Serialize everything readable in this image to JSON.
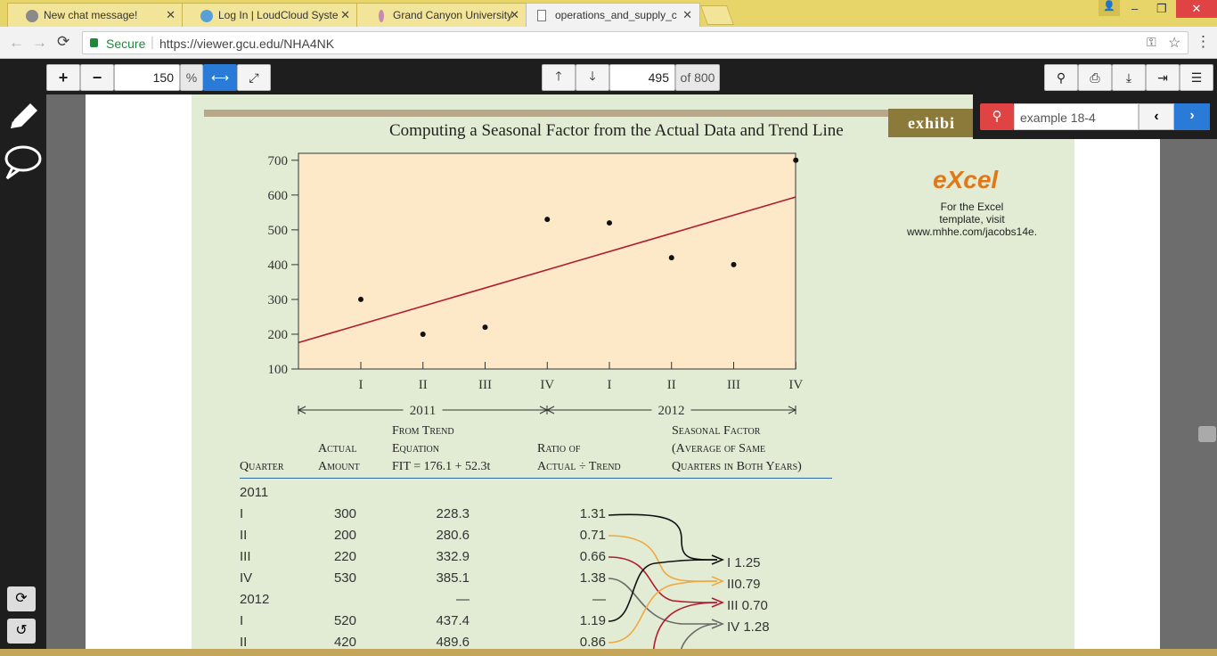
{
  "browser": {
    "tabs": [
      {
        "title": "New chat message!"
      },
      {
        "title": "Log In | LoudCloud Syste"
      },
      {
        "title": "Grand Canyon University"
      },
      {
        "title": "operations_and_supply_c"
      }
    ],
    "secure_label": "Secure",
    "url": "https://viewer.gcu.edu/NHA4NK"
  },
  "viewer": {
    "zoom_value": "150",
    "zoom_unit": "%",
    "page_value": "495",
    "page_total": "of 800",
    "find_value": "example 18-4"
  },
  "document": {
    "exhibit_tab": "exhibi",
    "chart_title": "Computing a Seasonal Factor from the Actual Data and Trend Line",
    "excel_logo": "eXcel",
    "excel_note": [
      "For the Excel",
      "template, visit",
      "www.mhhe.com/jacobs14e."
    ],
    "year_labels": [
      "2011",
      "2012"
    ],
    "table": {
      "headers": {
        "quarter": "Quarter",
        "actual": [
          "Actual",
          "Amount"
        ],
        "trend": [
          "From Trend",
          "Equation",
          "FIT = 176.1 + 52.3t"
        ],
        "ratio": [
          "Ratio of",
          "Actual ÷ Trend"
        ],
        "seasonal": [
          "Seasonal Factor",
          "(Average of Same",
          "Quarters in Both Years)"
        ]
      },
      "rows": [
        {
          "q": "2011",
          "a": "",
          "t": "",
          "r": ""
        },
        {
          "q": "I",
          "a": "300",
          "t": "228.3",
          "r": "1.31"
        },
        {
          "q": "II",
          "a": "200",
          "t": "280.6",
          "r": "0.71"
        },
        {
          "q": "III",
          "a": "220",
          "t": "332.9",
          "r": "0.66"
        },
        {
          "q": "IV",
          "a": "530",
          "t": "385.1",
          "r": "1.38"
        },
        {
          "q": "2012",
          "a": "",
          "t": "—",
          "r": "—"
        },
        {
          "q": "I",
          "a": "520",
          "t": "437.4",
          "r": "1.19"
        },
        {
          "q": "II",
          "a": "420",
          "t": "489.6",
          "r": "0.86"
        }
      ],
      "seasonal_factors": [
        "I  1.25",
        "II0.79",
        "III 0.70",
        "IV 1.28"
      ]
    }
  },
  "chart_data": {
    "type": "scatter",
    "categories": [
      "I",
      "II",
      "III",
      "IV",
      "I",
      "II",
      "III",
      "IV"
    ],
    "x": [
      1,
      2,
      3,
      4,
      5,
      6,
      7,
      8
    ],
    "y": [
      300,
      200,
      220,
      530,
      520,
      420,
      400,
      700
    ],
    "trend_line": {
      "intercept": 176.1,
      "slope": 52.3
    },
    "yticks": [
      100,
      200,
      300,
      400,
      500,
      600,
      700
    ],
    "ylim": [
      100,
      720
    ],
    "xlim": [
      0,
      8
    ],
    "title": "Computing a Seasonal Factor from the Actual Data and Trend Line",
    "colors": {
      "plot_bg": "#fde8c8",
      "trend": "#b01c2e",
      "points": "#111111"
    }
  }
}
